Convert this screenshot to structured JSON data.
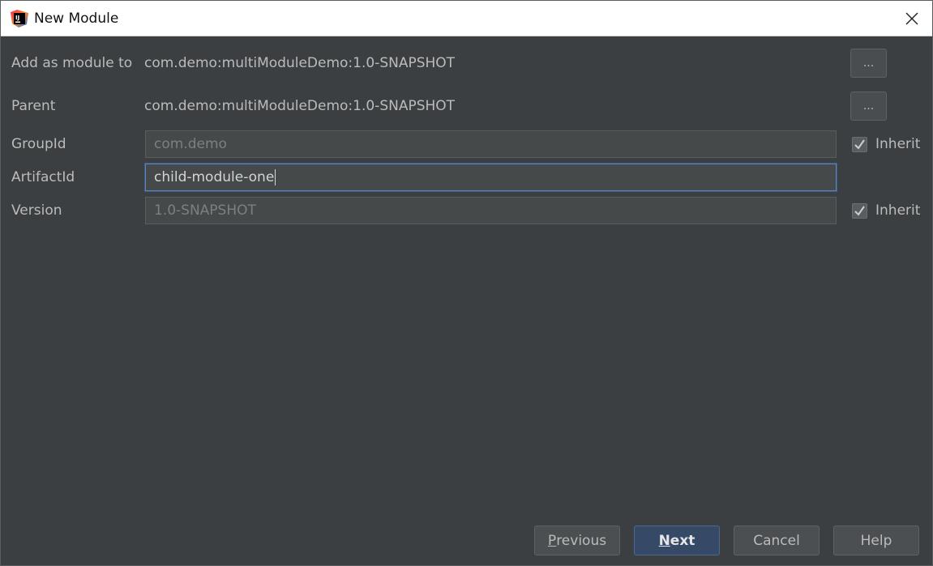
{
  "window": {
    "title": "New Module",
    "colors": {
      "background": "#3c3f41",
      "primary_button": "#364a68",
      "focus_border": "#5e82b5"
    }
  },
  "form": {
    "add_as_module_to": {
      "label": "Add as module to",
      "value": "com.demo:multiModuleDemo:1.0-SNAPSHOT",
      "button_label": "..."
    },
    "parent": {
      "label": "Parent",
      "value": "com.demo:multiModuleDemo:1.0-SNAPSHOT",
      "button_label": "..."
    },
    "group_id": {
      "label": "GroupId",
      "value": "com.demo",
      "inherit_label": "Inherit",
      "inherit_checked": true
    },
    "artifact_id": {
      "label": "ArtifactId",
      "value": "child-module-one"
    },
    "version": {
      "label": "Version",
      "value": "1.0-SNAPSHOT",
      "inherit_label": "Inherit",
      "inherit_checked": true
    }
  },
  "footer": {
    "previous": {
      "mnemonic": "P",
      "rest": "revious"
    },
    "next": {
      "mnemonic": "N",
      "rest": "ext"
    },
    "cancel": "Cancel",
    "help": "Help"
  }
}
